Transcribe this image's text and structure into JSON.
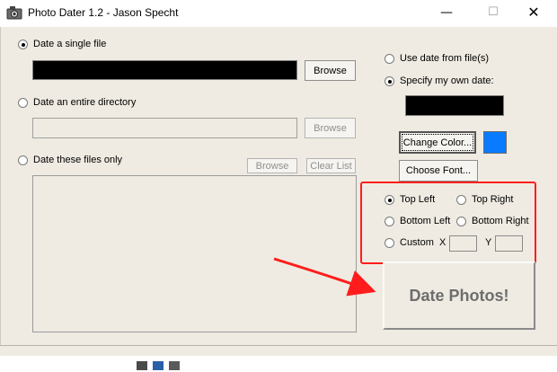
{
  "window": {
    "title": "Photo Dater 1.2 - Jason Specht",
    "minimize_glyph": "—",
    "maximize_glyph": "☐",
    "close_glyph": "✕"
  },
  "source": {
    "single_file_label": "Date a single file",
    "single_file_checked": true,
    "single_file_value": "",
    "browse_label": "Browse",
    "directory_label": "Date an entire directory",
    "directory_value": "",
    "files_only_label": "Date these files only",
    "clear_list_label": "Clear List",
    "file_list_items": []
  },
  "date_source": {
    "from_file_label": "Use date from file(s)",
    "own_date_label": "Specify my own date:",
    "own_date_checked": true,
    "own_date_value": ""
  },
  "appearance": {
    "change_color_label": "Change Color...",
    "choose_font_label": "Choose Font...",
    "text_color": "#0a7bff"
  },
  "position": {
    "top_left_label": "Top Left",
    "top_right_label": "Top Right",
    "bottom_left_label": "Bottom Left",
    "bottom_right_label": "Bottom Right",
    "custom_label": "Custom",
    "selected": "Top Left",
    "x_label": "X",
    "y_label": "Y",
    "x_value": "",
    "y_value": ""
  },
  "actions": {
    "date_photos_label": "Date Photos!"
  },
  "annotation": {
    "box_color": "#ff1c1c",
    "arrow_color": "#ff1c1c"
  },
  "icons": {
    "app": "camera-icon",
    "minimize": "minimize-icon",
    "maximize": "maximize-icon",
    "close": "close-icon"
  }
}
